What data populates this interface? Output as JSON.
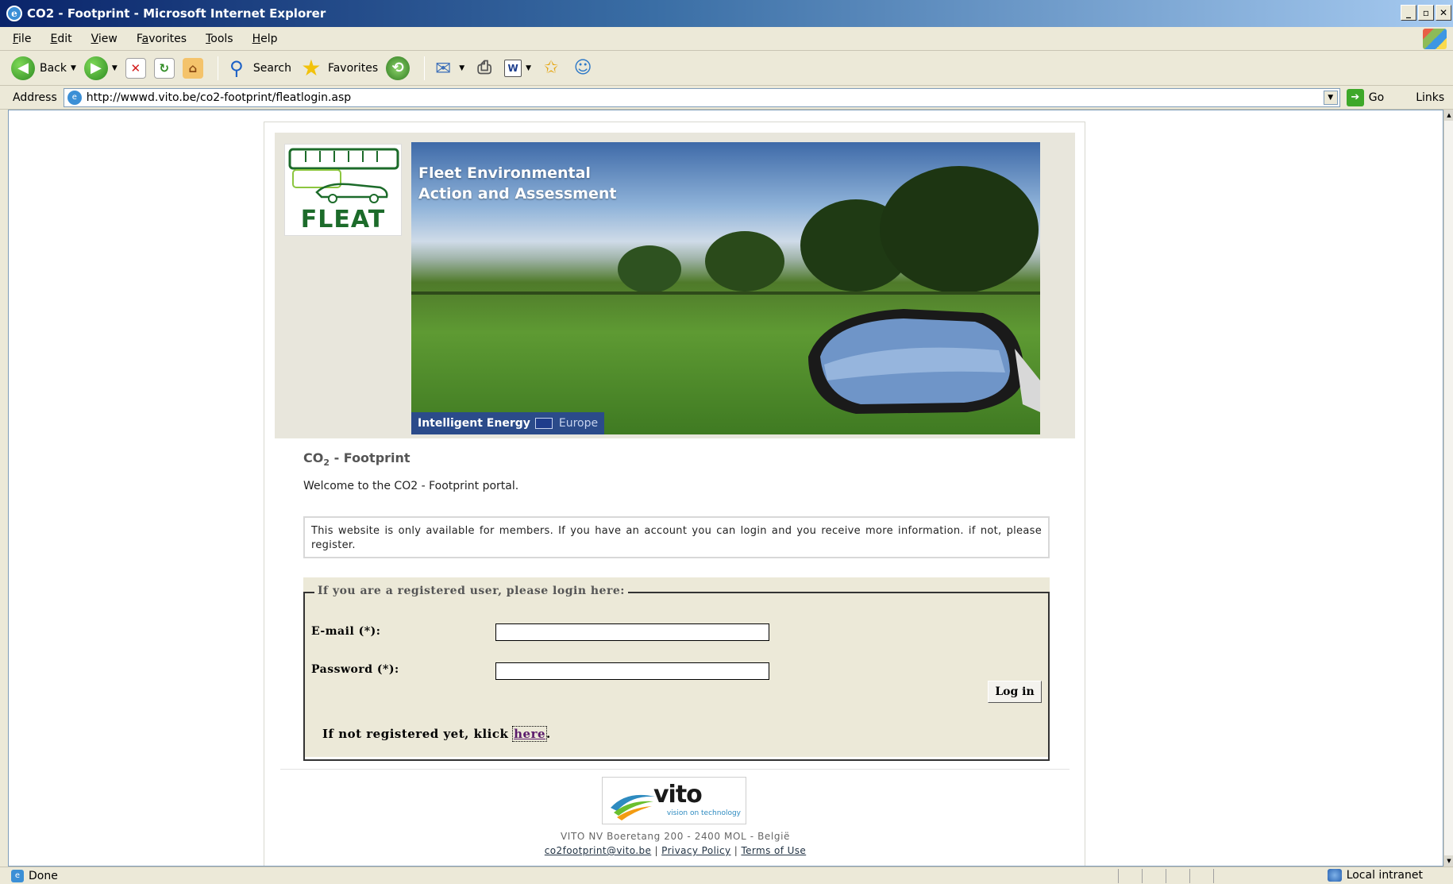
{
  "window": {
    "title": "CO2 - Footprint - Microsoft Internet Explorer",
    "minimize": "_",
    "restore": "▫",
    "close": "✕"
  },
  "menu": {
    "items": [
      {
        "label": "File",
        "u": "F",
        "rest": "ile"
      },
      {
        "label": "Edit",
        "u": "E",
        "rest": "dit"
      },
      {
        "label": "View",
        "u": "V",
        "rest": "iew"
      },
      {
        "label": "Favorites",
        "pre": "F",
        "u": "a",
        "rest": "vorites"
      },
      {
        "label": "Tools",
        "u": "T",
        "rest": "ools"
      },
      {
        "label": "Help",
        "u": "H",
        "rest": "elp"
      }
    ]
  },
  "toolbar": {
    "back_label": "Back",
    "search_label": "Search",
    "favorites_label": "Favorites"
  },
  "address": {
    "label": "Address",
    "url": "http://wwwd.vito.be/co2-footprint/fleatlogin.asp",
    "go_label": "Go",
    "links_label": "Links"
  },
  "banner": {
    "logo_text": "FLEAT",
    "title_line1": "Fleet Environmental",
    "title_line2": "Action and Assessment",
    "badge_text": "Intelligent Energy",
    "badge_europe": "Europe"
  },
  "content": {
    "heading_pre": "CO",
    "heading_sub": "2",
    "heading_post": " - Footprint",
    "welcome": "Welcome to the CO2 - Footprint portal.",
    "info": "This website is only available for members. If you have an account you can login and you receive more information. if not, please register."
  },
  "login": {
    "legend": "If you are a registered user, please login here:",
    "email_label": "E-mail (*):",
    "email_value": "",
    "password_label": "Password (*):",
    "password_value": "",
    "login_button": "Log in",
    "register_text": "If not registered yet, klick ",
    "register_link": "here",
    "register_end": "."
  },
  "footer": {
    "logo_text": "vito",
    "logo_tagline": "vision on technology",
    "address": "VITO NV Boeretang 200 - 2400 MOL - België",
    "email": "co2footprint@vito.be",
    "privacy": "Privacy Policy",
    "terms": "Terms of Use",
    "sep": "|"
  },
  "status": {
    "text": "Done",
    "zone": "Local intranet"
  }
}
